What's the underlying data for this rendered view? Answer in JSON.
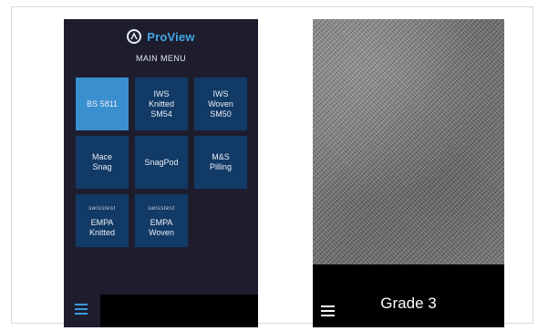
{
  "left_screen": {
    "brand": {
      "name": "ProView",
      "logo_icon": "proview-logo-icon"
    },
    "menu_title": "MAIN MENU",
    "tiles": [
      {
        "label": "BS 5811",
        "active": true
      },
      {
        "label": "IWS\nKnitted\nSM54"
      },
      {
        "label": "IWS\nWoven\nSM50"
      },
      {
        "label": "Mace\nSnag"
      },
      {
        "label": "SnagPod"
      },
      {
        "label": "M&S\nPilling"
      },
      {
        "label": "EMPA\nKnitted",
        "badge": "swisstest"
      },
      {
        "label": "EMPA\nWoven",
        "badge": "swisstest"
      }
    ],
    "menu_icon": "hamburger-menu-icon"
  },
  "right_screen": {
    "grade_label": "Grade 3",
    "menu_icon": "hamburger-menu-icon"
  },
  "colors": {
    "background": "#1d1d2e",
    "tile": "#123a66",
    "tile_active": "#3a8fcf",
    "brand_text": "#41a8e6"
  }
}
